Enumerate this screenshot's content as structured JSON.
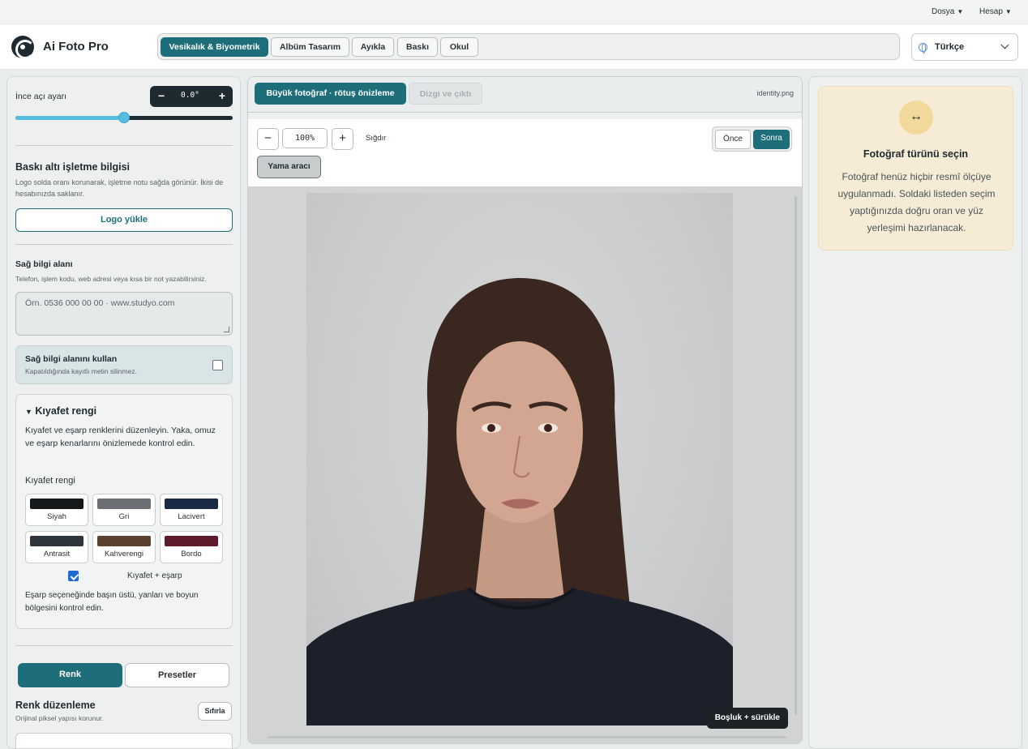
{
  "menu": {
    "file": "Dosya",
    "account": "Hesap"
  },
  "app": {
    "title": "Ai Foto Pro"
  },
  "tabs": [
    {
      "label": "Vesikalık & Biyometrik",
      "active": true
    },
    {
      "label": "Albüm Tasarım",
      "active": false
    },
    {
      "label": "Ayıkla",
      "active": false
    },
    {
      "label": "Baskı",
      "active": false
    },
    {
      "label": "Okul",
      "active": false
    }
  ],
  "language": {
    "selected": "Türkçe"
  },
  "left": {
    "angle": {
      "label": "İnce açı ayarı",
      "value": "0.0°",
      "minus": "−",
      "plus": "+",
      "slider_fraction": 0.5
    },
    "footer_info": {
      "title": "Baskı altı işletme bilgisi",
      "help": "Logo solda oranı korunarak, işletme notu sağda görünür. İkisi de hesabınızda saklanır.",
      "upload_logo": "Logo yükle"
    },
    "right_info": {
      "title": "Sağ bilgi alanı",
      "help": "Telefon, işlem kodu, web adresi veya kısa bir not yazabilirsiniz.",
      "placeholder": "Örn. 0536 000 00 00 · www.studyo.com",
      "toggle_title": "Sağ bilgi alanını kullan",
      "toggle_help": "Kapatıldığında kayıtlı metin silinmez.",
      "toggle_on": false
    },
    "clothing": {
      "title": "Kıyafet rengi",
      "collapse_marker": "▼",
      "desc": "Kıyafet ve eşarp renklerini düzenleyin. Yaka, omuz ve eşarp kenarlarını önizlemede kontrol edin.",
      "sub": "Kıyafet rengi",
      "swatches": [
        {
          "label": "Siyah",
          "color": "#16191c"
        },
        {
          "label": "Gri",
          "color": "#6b6e72"
        },
        {
          "label": "Lacivert",
          "color": "#1b2a45"
        },
        {
          "label": "Antrasit",
          "color": "#2f353c"
        },
        {
          "label": "Kahverengi",
          "color": "#5b4230"
        },
        {
          "label": "Bordo",
          "color": "#5c1a2a"
        }
      ],
      "scarf_label": "Kıyafet + eşarp",
      "scarf_on": true,
      "scarf_note": "Eşarp seçeneğinde başın üstü, yanları ve boyun bölgesini kontrol edin."
    },
    "bottom": {
      "tab_color": "Renk",
      "tab_presets": "Presetler",
      "color_edit_title": "Renk düzenleme",
      "color_edit_help": "Orijinal piksel yapısı korunur.",
      "reset": "Sıfırla"
    }
  },
  "center": {
    "tab_preview": "Büyük fotoğraf · rötuş önizleme",
    "tab_layout": "Dizgi ve çıktı",
    "filename": "identity.png",
    "zoom": "100%",
    "zoom_out": "−",
    "zoom_in": "+",
    "fit": "Sığdır",
    "before": "Önce",
    "after": "Sonra",
    "patch_tool": "Yama aracı",
    "hint": "Boşluk + sürükle"
  },
  "right": {
    "icon": "↔",
    "title": "Fotoğraf türünü seçin",
    "body": "Fotoğraf henüz hiçbir resmî ölçüye uygulanmadı. Soldaki listeden seçim yaptığınızda doğru oran ve yüz yerleşimi hazırlanacak."
  },
  "colors": {
    "accent": "#1e6e7a",
    "slider": "#55bde0",
    "info_bg": "#f6ecd5"
  }
}
